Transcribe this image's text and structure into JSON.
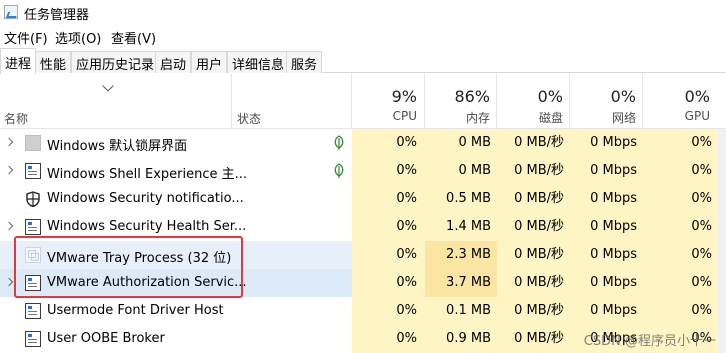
{
  "window": {
    "title": "任务管理器"
  },
  "menu": [
    "文件(F)",
    "选项(O)",
    "查看(V)"
  ],
  "tabs": [
    "进程",
    "性能",
    "应用历史记录",
    "启动",
    "用户",
    "详细信息",
    "服务"
  ],
  "header": {
    "name": "名称",
    "status": "状态",
    "metrics": [
      {
        "pct": "9%",
        "label": "CPU"
      },
      {
        "pct": "86%",
        "label": "内存"
      },
      {
        "pct": "0%",
        "label": "磁盘"
      },
      {
        "pct": "0%",
        "label": "网络"
      },
      {
        "pct": "0%",
        "label": "GPU"
      }
    ]
  },
  "processes": [
    {
      "name": "Windows 默认锁屏界面",
      "icon": "gray-square-icon",
      "expandable": true,
      "suspended_leaf": true,
      "cpu": "0%",
      "mem": "0 MB",
      "disk": "0 MB/秒",
      "net": "0 Mbps",
      "gpu": "0%"
    },
    {
      "name": "Windows Shell Experience 主...",
      "icon": "window-app-icon",
      "expandable": true,
      "suspended_leaf": true,
      "cpu": "0%",
      "mem": "0 MB",
      "disk": "0 MB/秒",
      "net": "0 Mbps",
      "gpu": "0%"
    },
    {
      "name": "Windows Security notificatio...",
      "icon": "shield-icon",
      "expandable": false,
      "suspended_leaf": false,
      "cpu": "0%",
      "mem": "0.5 MB",
      "disk": "0 MB/秒",
      "net": "0 Mbps",
      "gpu": "0%"
    },
    {
      "name": "Windows Security Health Ser...",
      "icon": "window-app-icon",
      "expandable": true,
      "suspended_leaf": false,
      "cpu": "0%",
      "mem": "1.4 MB",
      "disk": "0 MB/秒",
      "net": "0 Mbps",
      "gpu": "0%"
    },
    {
      "name": "VMware Tray Process (32 位)",
      "icon": "vmware-tray-icon",
      "expandable": false,
      "suspended_leaf": false,
      "cpu": "0%",
      "mem": "2.3 MB",
      "disk": "0 MB/秒",
      "net": "0 Mbps",
      "gpu": "0%"
    },
    {
      "name": "VMware Authorization Servic...",
      "icon": "window-app-icon",
      "expandable": true,
      "suspended_leaf": false,
      "cpu": "0%",
      "mem": "3.7 MB",
      "disk": "0 MB/秒",
      "net": "0 Mbps",
      "gpu": "0%"
    },
    {
      "name": "Usermode Font Driver Host",
      "icon": "window-app-icon",
      "expandable": false,
      "suspended_leaf": false,
      "cpu": "0%",
      "mem": "0.1 MB",
      "disk": "0 MB/秒",
      "net": "0 Mbps",
      "gpu": "0%"
    },
    {
      "name": "User OOBE Broker",
      "icon": "window-app-icon",
      "expandable": false,
      "suspended_leaf": false,
      "cpu": "0%",
      "mem": "0.9 MB",
      "disk": "0 MB/秒",
      "net": "0 Mbps",
      "gpu": "0%"
    }
  ],
  "watermark": "CSDN @程序员小十一",
  "colors": {
    "heat_light": "#fff4c4",
    "heat_deep": "#fae5a3",
    "selection": "#e7f0fa",
    "highlight": "#e4393c"
  }
}
